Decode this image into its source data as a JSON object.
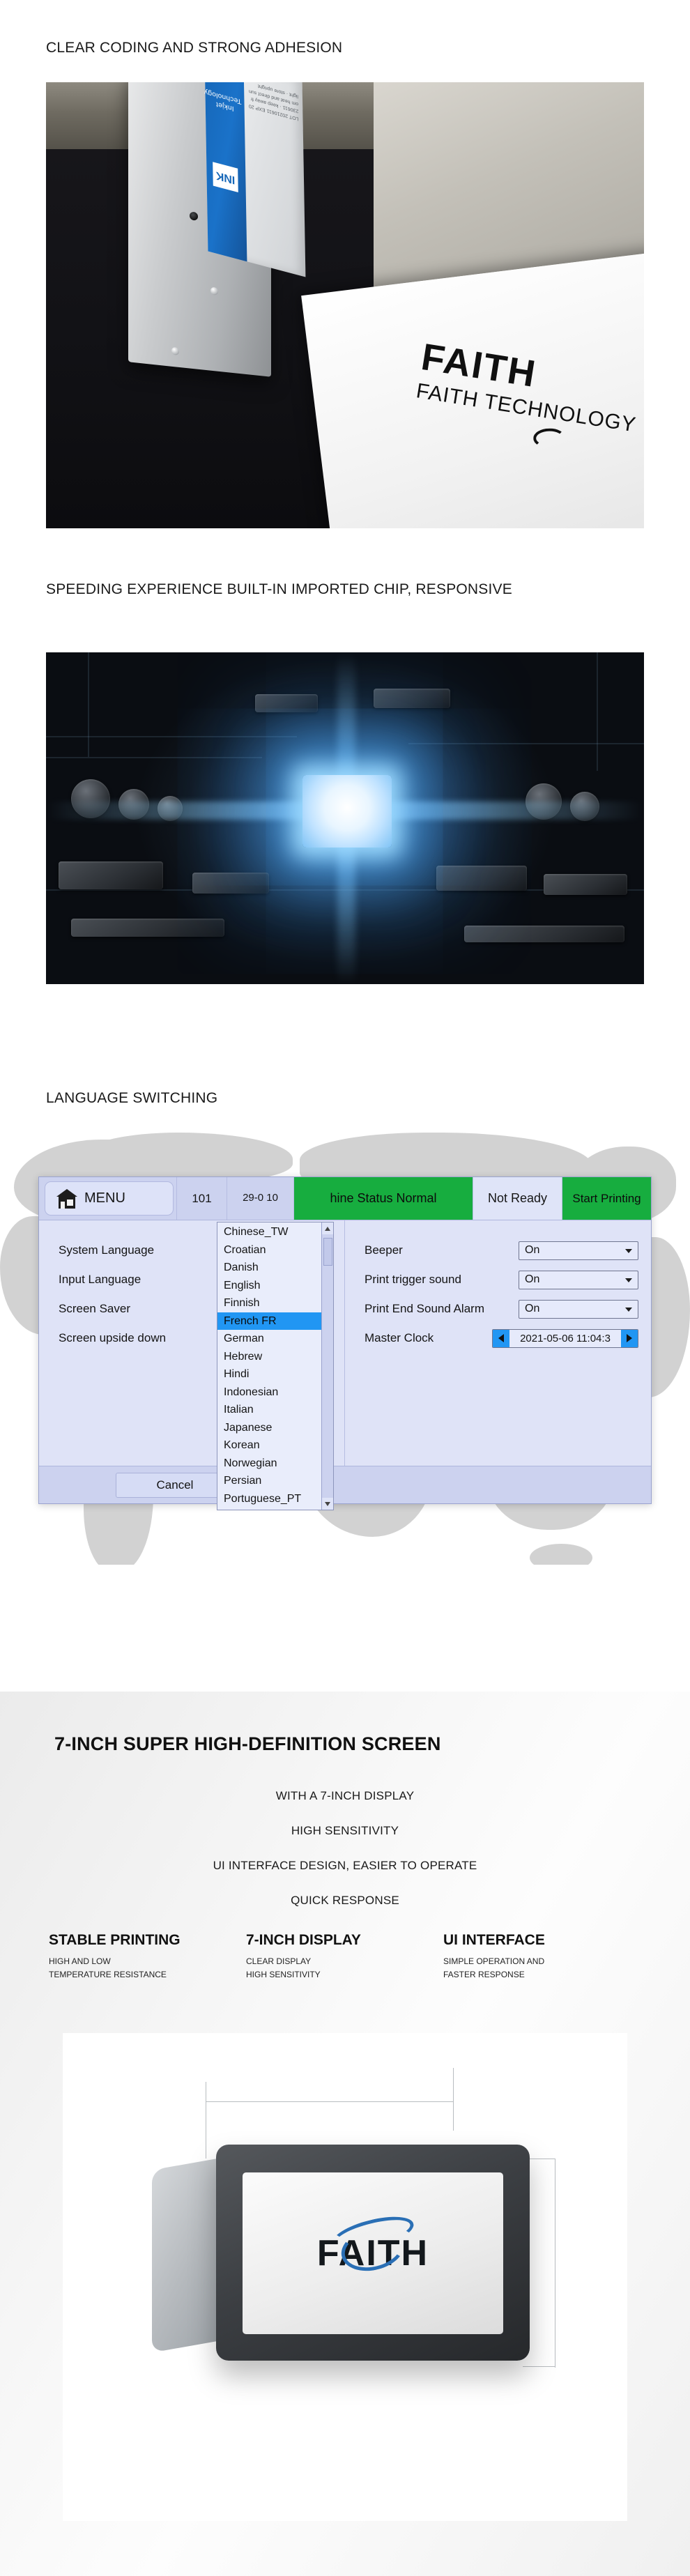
{
  "sections": {
    "clear_coding": {
      "title": "CLEAR CODING AND STRONG ADHESION",
      "photo": {
        "ink_box_label": "Inkjet Technology",
        "ink_box_mark": "INK",
        "ink_box_fineprint": "LOT 20210611 EXP 20230611 · keep away from heat and direct sunlight · store upright",
        "paper_logo_brand": "FAITH",
        "paper_logo_sub": "FAITH TECHNOLOGY"
      }
    },
    "speeding": {
      "title": "SPEEDING EXPERIENCE BUILT-IN IMPORTED CHIP, RESPONSIVE"
    },
    "language_switching": {
      "title": "LANGUAGE SWITCHING",
      "hmi": {
        "menu_label": "MENU",
        "menu_icon": "home-icon",
        "counter": "101",
        "datetime": "29-0 10",
        "machine_status": "hine Status Normal",
        "ready_status": "Not Ready",
        "print_button": "Start Printing",
        "cancel_button": "Cancel",
        "left_rows": [
          {
            "label": "System Language"
          },
          {
            "label": "Input Language"
          },
          {
            "label": "Screen Saver"
          },
          {
            "label": "Screen upside down"
          }
        ],
        "right_rows": [
          {
            "label": "Beeper",
            "value": "On",
            "type": "dropdown"
          },
          {
            "label": "Print trigger sound",
            "value": "On",
            "type": "dropdown"
          },
          {
            "label": "Print End Sound Alarm",
            "value": "On",
            "type": "dropdown"
          },
          {
            "label": "Master Clock",
            "value": "2021-05-06 11:04:3",
            "type": "spinner"
          }
        ],
        "language_list": {
          "selected": "French  FR",
          "items": [
            "Chinese_TW",
            "Croatian",
            "Danish",
            "English",
            "Finnish",
            "French  FR",
            "German",
            "Hebrew",
            "Hindi",
            "Indonesian",
            "Italian",
            "Japanese",
            "Korean",
            "Norwegian",
            "Persian",
            "Portuguese_PT"
          ]
        }
      }
    },
    "screen": {
      "heading": "7-INCH SUPER HIGH-DEFINITION SCREEN",
      "lines": [
        "WITH A 7-INCH DISPLAY",
        "HIGH SENSITIVITY",
        "UI INTERFACE DESIGN, EASIER TO OPERATE",
        "QUICK RESPONSE"
      ],
      "columns": [
        {
          "heading": "STABLE PRINTING",
          "desc": "HIGH AND LOW\nTEMPERATURE RESISTANCE"
        },
        {
          "heading": "7-INCH DISPLAY",
          "desc": "CLEAR DISPLAY\nHIGH SENSITIVITY"
        },
        {
          "heading": "UI INTERFACE",
          "desc": "SIMPLE OPERATION AND\nFASTER RESPONSE"
        }
      ],
      "device_logo": "FAITH"
    }
  },
  "colors": {
    "status_green": "#17ad3f",
    "selection_blue": "#2196f3",
    "panel_blue": "#dfe3f7",
    "panel_header": "#ccd2ef",
    "logo_blue": "#2a6fb5"
  }
}
